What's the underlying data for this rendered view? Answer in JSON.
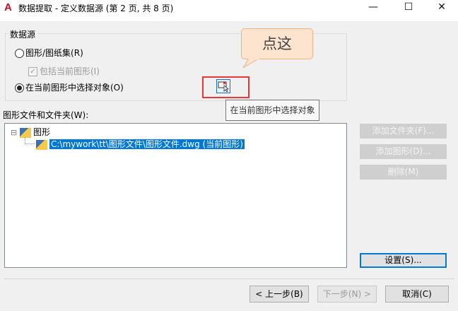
{
  "window": {
    "title": "数据提取 - 定义数据源 (第 2 页, 共 8 页)",
    "minimize": "—",
    "maximize": "☐",
    "close": "✕"
  },
  "datasource": {
    "group_label": "数据源",
    "radio_drawings": "图形/图纸集(R)",
    "include_current": "包括当前图形(I)",
    "radio_select_objects": "在当前图形中选择对象(O)",
    "selected": "select_objects"
  },
  "callout": {
    "text": "点这"
  },
  "tooltip": {
    "text": "在当前图形中选择对象"
  },
  "tree": {
    "label": "图形文件和文件夹(W):",
    "root": "图形",
    "items": [
      "C:\\mywork\\tt\\图形文件\\图形文件.dwg (当前图形)"
    ],
    "expander": "⊟"
  },
  "buttons": {
    "add_folder": "添加文件夹(F)...",
    "add_drawing": "添加图形(D)...",
    "remove": "删除(M)",
    "settings": "设置(S)...",
    "back": "< 上一步(B)",
    "next": "下一步(N) >",
    "cancel": "取消(C)"
  }
}
